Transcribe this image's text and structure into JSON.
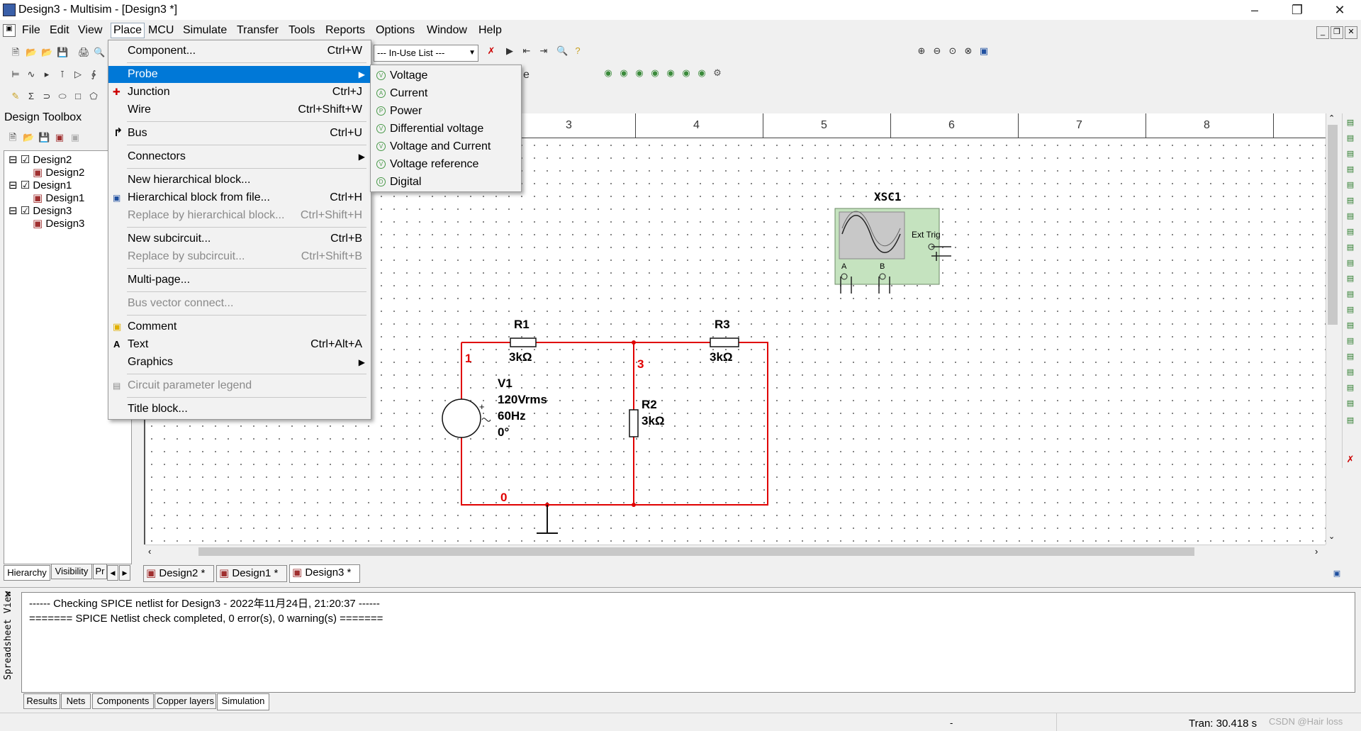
{
  "window": {
    "title": "Design3 - Multisim - [Design3 *]"
  },
  "menubar": {
    "items": [
      "File",
      "Edit",
      "View",
      "Place",
      "MCU",
      "Simulate",
      "Transfer",
      "Tools",
      "Reports",
      "Options",
      "Window",
      "Help"
    ]
  },
  "toolbar": {
    "inuse_list": "--- In-Use List ---"
  },
  "toolbox": {
    "title": "Design Toolbox",
    "tree": [
      {
        "label": "Design2",
        "child": "Design2"
      },
      {
        "label": "Design1",
        "child": "Design1"
      },
      {
        "label": "Design3",
        "child": "Design3"
      }
    ],
    "tabs": [
      "Hierarchy",
      "Visibility",
      "Pr"
    ]
  },
  "place_menu": {
    "items": [
      {
        "label": "Component...",
        "shortcut": "Ctrl+W"
      },
      {
        "label": "Probe",
        "shortcut": ""
      },
      {
        "label": "Junction",
        "shortcut": "Ctrl+J"
      },
      {
        "label": "Wire",
        "shortcut": "Ctrl+Shift+W"
      },
      {
        "label": "Bus",
        "shortcut": "Ctrl+U"
      },
      {
        "label": "Connectors",
        "shortcut": ""
      },
      {
        "label": "New hierarchical block...",
        "shortcut": ""
      },
      {
        "label": "Hierarchical block from file...",
        "shortcut": "Ctrl+H"
      },
      {
        "label": "Replace by hierarchical block...",
        "shortcut": "Ctrl+Shift+H"
      },
      {
        "label": "New subcircuit...",
        "shortcut": "Ctrl+B"
      },
      {
        "label": "Replace by subcircuit...",
        "shortcut": "Ctrl+Shift+B"
      },
      {
        "label": "Multi-page...",
        "shortcut": ""
      },
      {
        "label": "Bus vector connect...",
        "shortcut": ""
      },
      {
        "label": "Comment",
        "shortcut": ""
      },
      {
        "label": "Text",
        "shortcut": "Ctrl+Alt+A"
      },
      {
        "label": "Graphics",
        "shortcut": ""
      },
      {
        "label": "Circuit parameter legend",
        "shortcut": ""
      },
      {
        "label": "Title block...",
        "shortcut": ""
      }
    ]
  },
  "probe_submenu": {
    "items": [
      "Voltage",
      "Current",
      "Power",
      "Differential voltage",
      "Voltage and Current",
      "Voltage reference",
      "Digital"
    ]
  },
  "ruler": {
    "numbers": [
      "3",
      "4",
      "5",
      "6",
      "7",
      "8"
    ]
  },
  "schematic": {
    "scope_label": "XSC1",
    "scope_ext": "Ext Trig",
    "scope_a": "A",
    "scope_b": "B",
    "r1": {
      "name": "R1",
      "value": "3kΩ"
    },
    "r2": {
      "name": "R2",
      "value": "3kΩ"
    },
    "r3": {
      "name": "R3",
      "value": "3kΩ"
    },
    "v1": {
      "name": "V1",
      "l1": "120Vrms",
      "l2": "60Hz",
      "l3": "0°"
    },
    "nodes": {
      "n1": "1",
      "n3": "3",
      "n0": "0"
    }
  },
  "doc_tabs": [
    "Design2 *",
    "Design1 *",
    "Design3 *"
  ],
  "output": {
    "lines": [
      "------ Checking SPICE netlist for Design3 - 2022年11月24日, 21:20:37 ------",
      "======= SPICE Netlist check completed, 0 error(s), 0 warning(s) ======="
    ],
    "side_label": "Spreadsheet View",
    "tabs": [
      "Results",
      "Nets",
      "Components",
      "Copper layers",
      "Simulation"
    ]
  },
  "status": {
    "mid": "-",
    "tran": "Tran: 30.418 s",
    "watermark": "CSDN @Hair loss"
  }
}
